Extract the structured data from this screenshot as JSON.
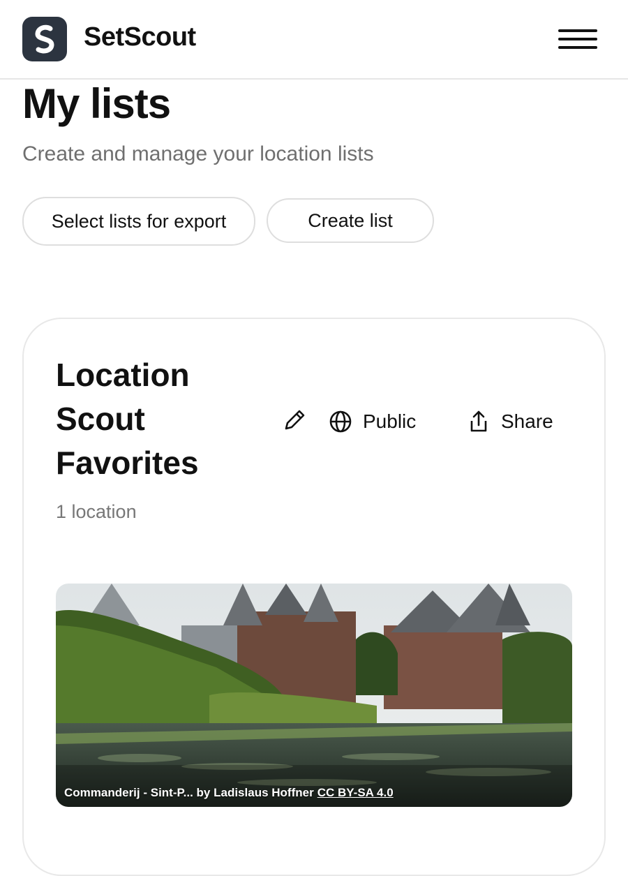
{
  "header": {
    "brand": "SetScout",
    "logo_icon": "setscout-s-logo",
    "menu_icon": "hamburger-menu-icon"
  },
  "page": {
    "title": "My lists",
    "subtitle": "Create and manage your location lists"
  },
  "actions": {
    "export_label": "Select lists for export",
    "create_label": "Create list"
  },
  "list": {
    "title": "Location Scout Favorites",
    "visibility_label": "Public",
    "share_label": "Share",
    "count_text": "1 location",
    "icons": [
      "pencil-icon",
      "globe-icon",
      "share-icon"
    ],
    "photo": {
      "caption": "Commanderij - Sint-P... by Ladislaus Hoffner",
      "license": "CC BY-SA 4.0"
    }
  },
  "colors": {
    "logo_bg": "#2c3440",
    "muted_text": "#6f6f6f",
    "border": "#e0e0e0"
  }
}
